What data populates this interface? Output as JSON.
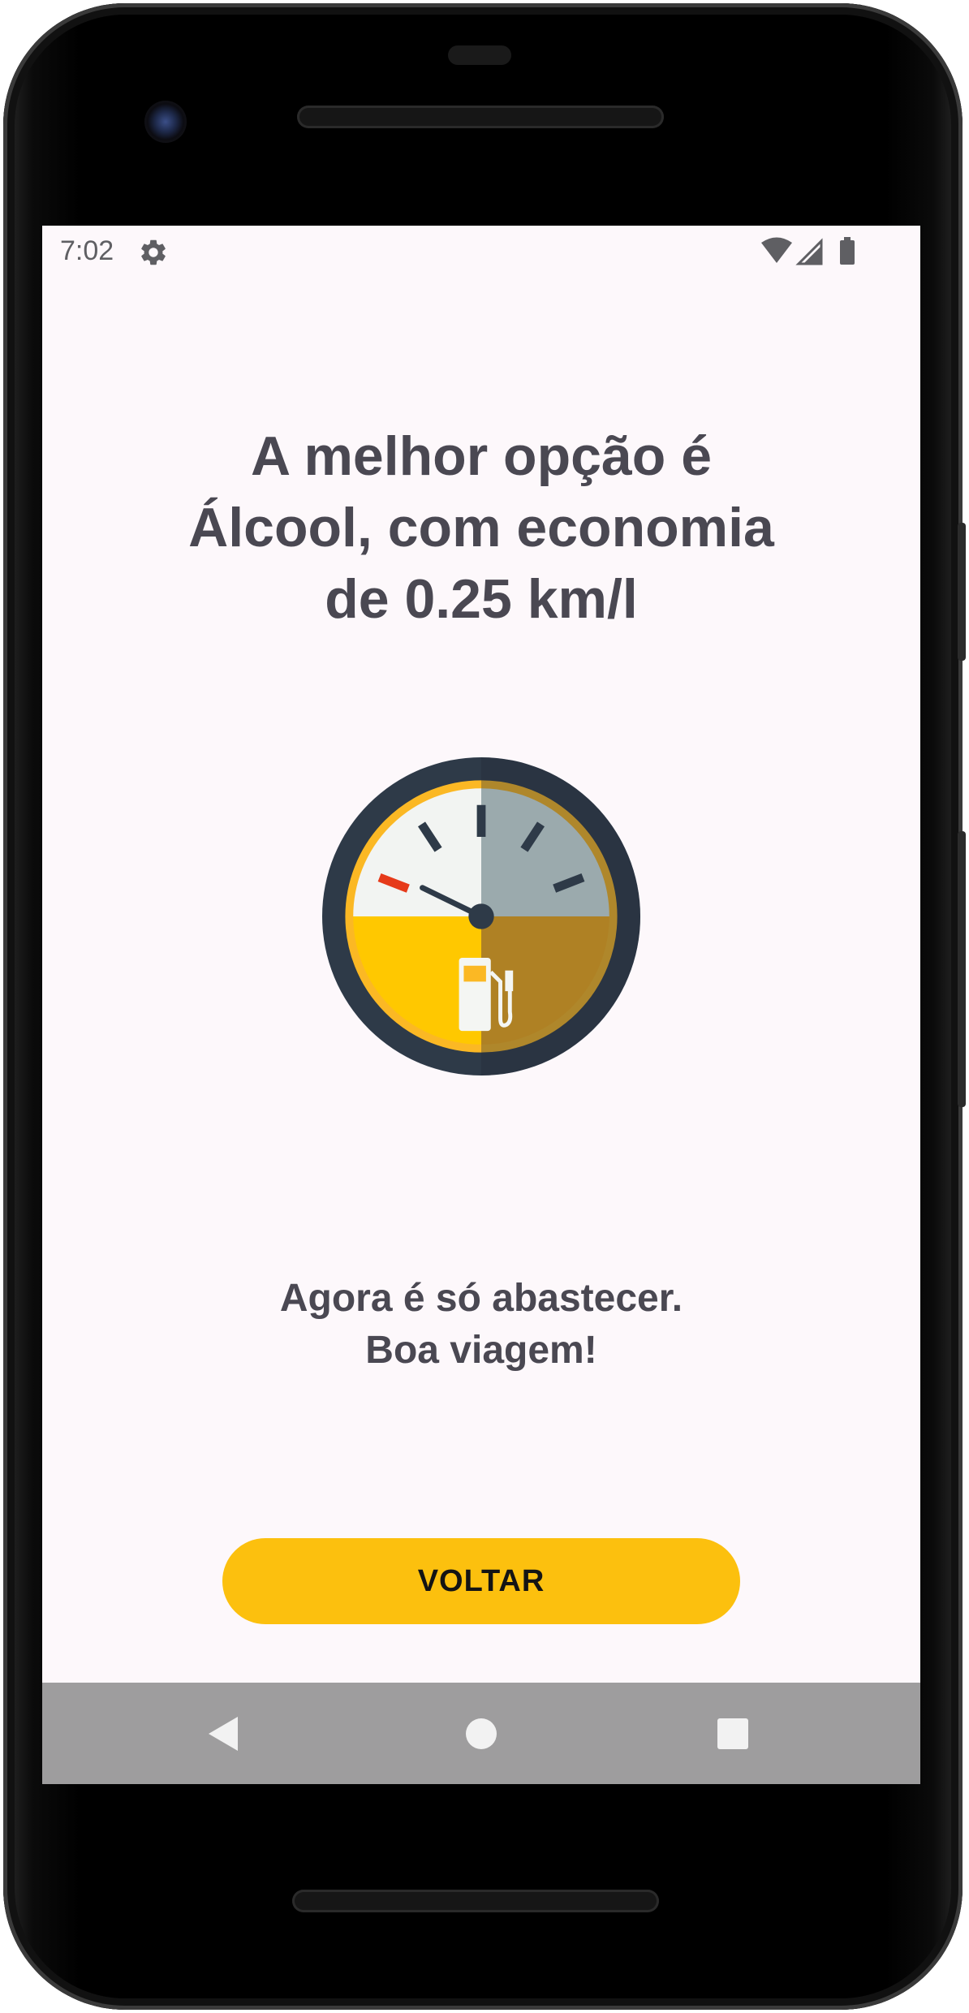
{
  "status_bar": {
    "time": "7:02",
    "icons": [
      "gear-icon",
      "wifi-icon",
      "signal-icon",
      "battery-icon"
    ]
  },
  "result": {
    "headline_line1": "A melhor opção é",
    "headline_line2": "Álcool, com economia",
    "headline_line3": "de 0.25 km/l",
    "subtext_line1": "Agora é só abastecer.",
    "subtext_line2": "Boa viagem!"
  },
  "actions": {
    "back_label": "VOLTAR"
  },
  "navigation": {
    "items": [
      "back-icon",
      "home-icon",
      "overview-icon"
    ]
  },
  "colors": {
    "screen_background": "#fdf8fb",
    "text": "#4a4852",
    "accent": "#fcc00e",
    "nav_bar": "#9e9d9e",
    "gauge_ring": "#2e3a48",
    "gauge_fill": "#ffc800",
    "gauge_red_mark": "#e63a1a"
  }
}
